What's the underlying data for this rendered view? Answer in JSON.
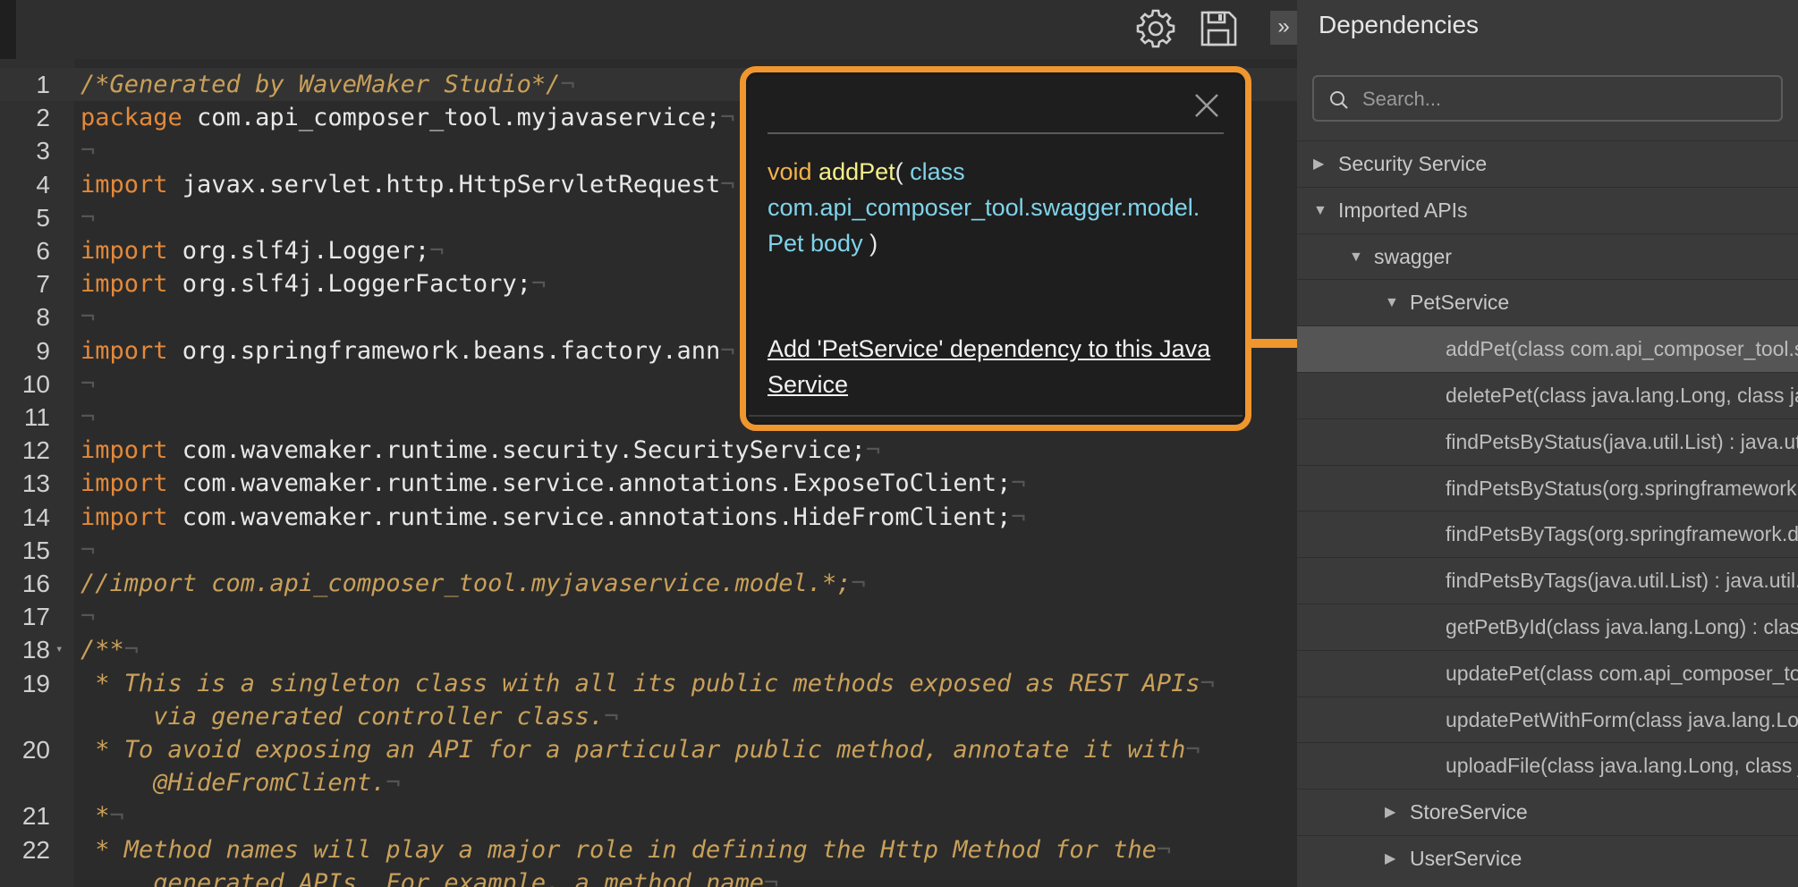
{
  "toolbar": {
    "settings_icon": "gear-icon",
    "save_icon": "save-icon"
  },
  "editor": {
    "lines": [
      {
        "n": "1",
        "parts": [
          {
            "t": "/*Generated by WaveMaker Studio*/",
            "c": "cm"
          }
        ]
      },
      {
        "n": "2",
        "parts": [
          {
            "t": "package",
            "c": "kw"
          },
          {
            "t": " com.api_composer_tool.myjavaservice;",
            "c": ""
          }
        ]
      },
      {
        "n": "3",
        "parts": []
      },
      {
        "n": "4",
        "parts": [
          {
            "t": "import",
            "c": "kw"
          },
          {
            "t": " javax.servlet.http.HttpServletRequest",
            "c": ""
          }
        ]
      },
      {
        "n": "5",
        "parts": []
      },
      {
        "n": "6",
        "parts": [
          {
            "t": "import",
            "c": "kw"
          },
          {
            "t": " org.slf4j.Logger;",
            "c": ""
          }
        ]
      },
      {
        "n": "7",
        "parts": [
          {
            "t": "import",
            "c": "kw"
          },
          {
            "t": " org.slf4j.LoggerFactory;",
            "c": ""
          }
        ]
      },
      {
        "n": "8",
        "parts": []
      },
      {
        "n": "9",
        "parts": [
          {
            "t": "import",
            "c": "kw"
          },
          {
            "t": " org.springframework.beans.factory.ann",
            "c": ""
          }
        ]
      },
      {
        "n": "10",
        "parts": []
      },
      {
        "n": "11",
        "parts": []
      },
      {
        "n": "12",
        "parts": [
          {
            "t": "import",
            "c": "kw"
          },
          {
            "t": " com.wavemaker.runtime.security.SecurityService;",
            "c": ""
          }
        ]
      },
      {
        "n": "13",
        "parts": [
          {
            "t": "import",
            "c": "kw"
          },
          {
            "t": " com.wavemaker.runtime.service.annotations.ExposeToClient;",
            "c": ""
          }
        ]
      },
      {
        "n": "14",
        "parts": [
          {
            "t": "import",
            "c": "kw"
          },
          {
            "t": " com.wavemaker.runtime.service.annotations.HideFromClient;",
            "c": ""
          }
        ]
      },
      {
        "n": "15",
        "parts": []
      },
      {
        "n": "16",
        "parts": [
          {
            "t": "//import com.api_composer_tool.myjavaservice.model.*;",
            "c": "cm"
          }
        ]
      },
      {
        "n": "17",
        "parts": []
      },
      {
        "n": "18",
        "parts": [
          {
            "t": "/**",
            "c": "cm"
          }
        ],
        "fold": true
      },
      {
        "n": "19",
        "parts": [
          {
            "t": " * This is a singleton class with all its public methods exposed as REST APIs",
            "c": "cm"
          }
        ]
      },
      {
        "n": "",
        "parts": [
          {
            "t": "     via generated controller class.",
            "c": "cm"
          }
        ]
      },
      {
        "n": "20",
        "parts": [
          {
            "t": " * To avoid exposing an API for a particular public method, annotate it with",
            "c": "cm"
          }
        ]
      },
      {
        "n": "",
        "parts": [
          {
            "t": "     @HideFromClient.",
            "c": "cm"
          }
        ]
      },
      {
        "n": "21",
        "parts": [
          {
            "t": " *",
            "c": "cm"
          }
        ]
      },
      {
        "n": "22",
        "parts": [
          {
            "t": " * Method names will play a major role in defining the Http Method for the",
            "c": "cm"
          }
        ]
      },
      {
        "n": "",
        "parts": [
          {
            "t": "     generated APIs. For example, a method name",
            "c": "cm"
          }
        ]
      }
    ]
  },
  "popup": {
    "close_icon": "close-icon",
    "sig_return": "void",
    "sig_method": "addPet",
    "sig_open": "(",
    "sig_class_kw": "class",
    "sig_type": "com.api_composer_tool.swagger.model.",
    "sig_param": "Pet body",
    "sig_close": ")",
    "link": "Add 'PetService' dependency to this Java Service"
  },
  "panel": {
    "collapse": "»",
    "title": "Dependencies",
    "search_placeholder": "Search...",
    "tree": [
      {
        "label": "Security Service",
        "level": 0,
        "state": "collapsed"
      },
      {
        "label": "Imported APIs",
        "level": 0,
        "state": "expanded"
      },
      {
        "label": "swagger",
        "level": 1,
        "state": "expanded"
      },
      {
        "label": "PetService",
        "level": 2,
        "state": "expanded"
      },
      {
        "label": "addPet(class com.api_composer_tool.swagger.model.Pet)",
        "level": 3,
        "state": "leaf",
        "selected": true
      },
      {
        "label": "deletePet(class java.lang.Long, class java.lang.String)",
        "level": 3,
        "state": "leaf"
      },
      {
        "label": "findPetsByStatus(java.util.List) : java.util.List",
        "level": 3,
        "state": "leaf"
      },
      {
        "label": "findPetsByStatus(org.springframework.data.domain.Pageable)",
        "level": 3,
        "state": "leaf"
      },
      {
        "label": "findPetsByTags(org.springframework.data.domain.Pageable)",
        "level": 3,
        "state": "leaf"
      },
      {
        "label": "findPetsByTags(java.util.List) : java.util.List",
        "level": 3,
        "state": "leaf"
      },
      {
        "label": "getPetById(class java.lang.Long) : class Pet",
        "level": 3,
        "state": "leaf"
      },
      {
        "label": "updatePet(class com.api_composer_tool.swagger.model.Pet)",
        "level": 3,
        "state": "leaf"
      },
      {
        "label": "updatePetWithForm(class java.lang.Long, class java.lang.String)",
        "level": 3,
        "state": "leaf"
      },
      {
        "label": "uploadFile(class java.lang.Long, class java.lang.String)",
        "level": 3,
        "state": "leaf"
      },
      {
        "label": "StoreService",
        "level": 2,
        "state": "collapsed"
      },
      {
        "label": "UserService",
        "level": 2,
        "state": "collapsed"
      }
    ]
  }
}
